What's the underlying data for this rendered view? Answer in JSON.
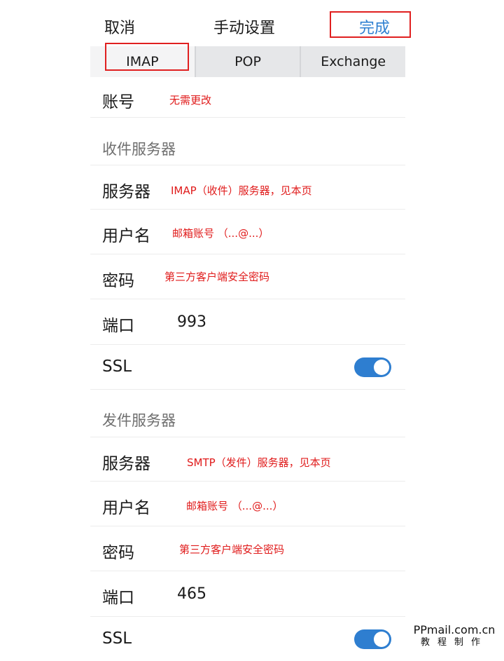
{
  "header": {
    "cancel_label": "取消",
    "title": "手动设置",
    "done_label": "完成"
  },
  "tabs": [
    {
      "label": "IMAP"
    },
    {
      "label": "POP"
    },
    {
      "label": "Exchange"
    }
  ],
  "account": {
    "label": "账号",
    "note": "无需更改"
  },
  "incoming": {
    "section_title": "收件服务器",
    "server": {
      "label": "服务器",
      "note": "IMAP（收件）服务器，见本页"
    },
    "username": {
      "label": "用户名",
      "note": "邮箱账号 （...@...）"
    },
    "password": {
      "label": "密码",
      "note": "第三方客户端安全密码"
    },
    "port": {
      "label": "端口",
      "value": "993"
    },
    "ssl": {
      "label": "SSL",
      "on": true
    }
  },
  "outgoing": {
    "section_title": "发件服务器",
    "server": {
      "label": "服务器",
      "note": "SMTP（发件）服务器，见本页"
    },
    "username": {
      "label": "用户名",
      "note": "邮箱账号 （...@...）"
    },
    "password": {
      "label": "密码",
      "note": "第三方客户端安全密码"
    },
    "port": {
      "label": "端口",
      "value": "465"
    },
    "ssl": {
      "label": "SSL",
      "on": true
    }
  },
  "watermark": {
    "line1": "PPmail.com.cn",
    "line2": "教程制作"
  },
  "colors": {
    "accent": "#2f80d1",
    "annotation": "#e01b1b",
    "toggle_on": "#2e7ed0"
  }
}
